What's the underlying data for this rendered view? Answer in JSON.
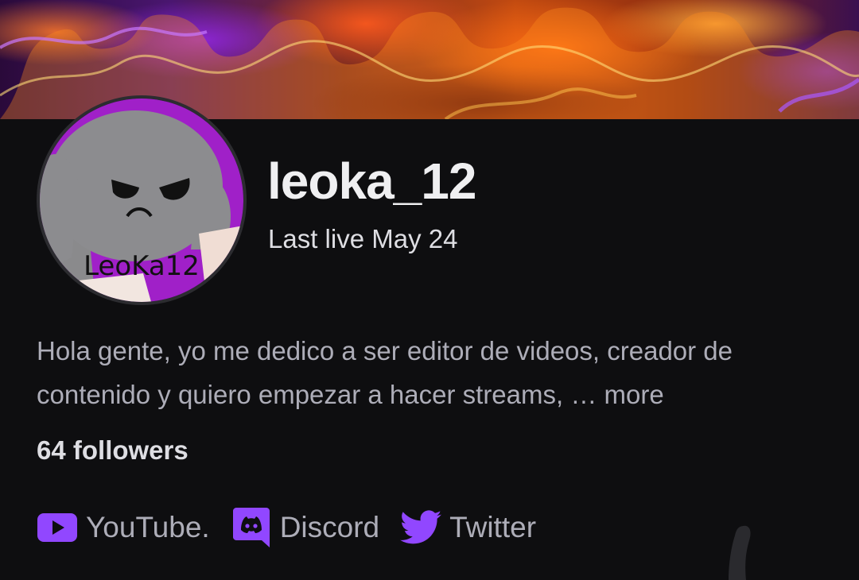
{
  "profile": {
    "username": "leoka_12",
    "last_live": "Last live May 24",
    "avatar_text": "LeoKa12",
    "bio_text": "Hola gente, yo me dedico a ser editor de videos, creador de contenido y quiero empezar a hacer streams, …",
    "bio_more": "more",
    "followers": "64 followers"
  },
  "socials": [
    {
      "label": "YouTube.",
      "icon": "youtube-icon"
    },
    {
      "label": "Discord",
      "icon": "discord-icon"
    },
    {
      "label": "Twitter",
      "icon": "twitter-icon"
    }
  ],
  "colors": {
    "background": "#0e0e10",
    "accent": "#9147ff",
    "text_primary": "#efeff1",
    "text_secondary": "#adadb8"
  }
}
